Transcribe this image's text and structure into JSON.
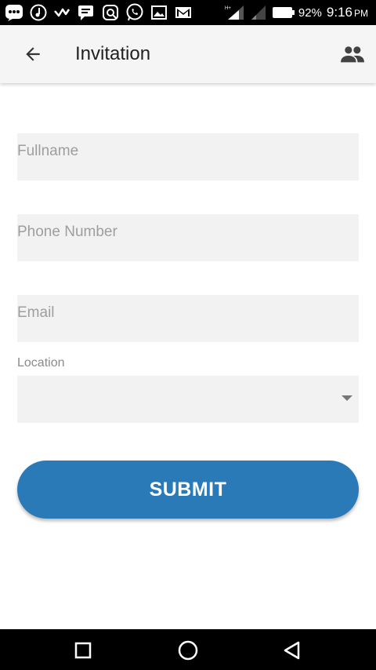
{
  "status_bar": {
    "battery_percent": "92%",
    "time": "9:16",
    "ampm": "PM",
    "icons": [
      "bbm-icon",
      "music-icon",
      "check-icon",
      "chat-icon",
      "photo-edit-icon",
      "whatsapp-icon",
      "gallery-icon",
      "gmail-icon",
      "signal-icon",
      "signal-weak-icon",
      "battery-icon"
    ]
  },
  "app_bar": {
    "title": "Invitation",
    "back_icon": "back-arrow-icon",
    "action_icon": "people-icon"
  },
  "form": {
    "fullname_placeholder": "Fullname",
    "phone_placeholder": "Phone Number",
    "email_placeholder": "Email",
    "location_label": "Location",
    "location_value": "",
    "submit_label": "SUBMIT"
  },
  "nav_bar": {
    "icons": [
      "recents-icon",
      "home-icon",
      "back-icon"
    ]
  },
  "colors": {
    "accent": "#2a7ab8",
    "app_bar_bg": "#f5f5f5",
    "field_bg": "#f2f2f2",
    "placeholder": "#9e9e9e"
  }
}
